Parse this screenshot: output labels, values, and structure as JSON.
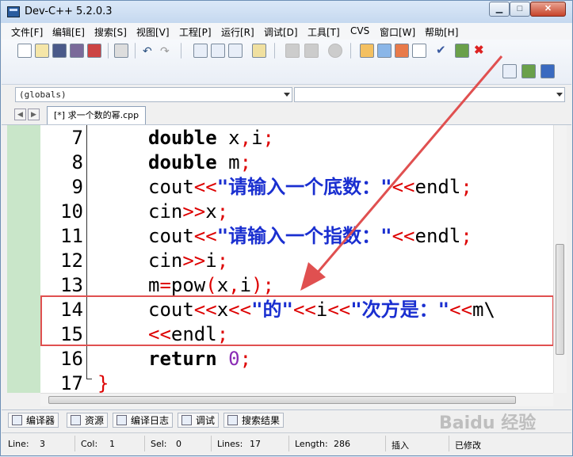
{
  "window": {
    "title": "Dev-C++ 5.2.0.3"
  },
  "menu": [
    "文件[F]",
    "编辑[E]",
    "搜索[S]",
    "视图[V]",
    "工程[P]",
    "运行[R]",
    "调试[D]",
    "工具[T]",
    "CVS",
    "窗口[W]",
    "帮助[H]"
  ],
  "scope_combo": {
    "value": "(globals)"
  },
  "tab": {
    "label": "[*] 求一个数的幂.cpp"
  },
  "code_lines": [
    {
      "num": "7",
      "segments": [
        {
          "t": "double",
          "c": "kw"
        },
        {
          "t": " x",
          "c": ""
        },
        {
          "t": ",",
          "c": "op"
        },
        {
          "t": "i",
          "c": ""
        },
        {
          "t": ";",
          "c": "op"
        }
      ]
    },
    {
      "num": "8",
      "segments": [
        {
          "t": "double",
          "c": "kw"
        },
        {
          "t": " m",
          "c": ""
        },
        {
          "t": ";",
          "c": "op"
        }
      ]
    },
    {
      "num": "9",
      "segments": [
        {
          "t": "cout",
          "c": ""
        },
        {
          "t": "<<",
          "c": "op"
        },
        {
          "t": "\"请输入一个底数：\"",
          "c": "str"
        },
        {
          "t": "<<",
          "c": "op"
        },
        {
          "t": "endl",
          "c": ""
        },
        {
          "t": ";",
          "c": "op"
        }
      ]
    },
    {
      "num": "10",
      "segments": [
        {
          "t": "cin",
          "c": ""
        },
        {
          "t": ">>",
          "c": "op"
        },
        {
          "t": "x",
          "c": ""
        },
        {
          "t": ";",
          "c": "op"
        }
      ]
    },
    {
      "num": "11",
      "segments": [
        {
          "t": "cout",
          "c": ""
        },
        {
          "t": "<<",
          "c": "op"
        },
        {
          "t": "\"请输入一个指数：\"",
          "c": "str"
        },
        {
          "t": "<<",
          "c": "op"
        },
        {
          "t": "endl",
          "c": ""
        },
        {
          "t": ";",
          "c": "op"
        }
      ]
    },
    {
      "num": "12",
      "segments": [
        {
          "t": "cin",
          "c": ""
        },
        {
          "t": ">>",
          "c": "op"
        },
        {
          "t": "i",
          "c": ""
        },
        {
          "t": ";",
          "c": "op"
        }
      ]
    },
    {
      "num": "13",
      "segments": [
        {
          "t": "m",
          "c": ""
        },
        {
          "t": "=",
          "c": "op"
        },
        {
          "t": "pow",
          "c": ""
        },
        {
          "t": "(",
          "c": "op"
        },
        {
          "t": "x",
          "c": ""
        },
        {
          "t": ",",
          "c": "op"
        },
        {
          "t": "i",
          "c": ""
        },
        {
          "t": ")",
          "c": "op"
        },
        {
          "t": ";",
          "c": "op"
        }
      ]
    },
    {
      "num": "14",
      "segments": [
        {
          "t": "cout",
          "c": ""
        },
        {
          "t": "<<",
          "c": "op"
        },
        {
          "t": "x",
          "c": ""
        },
        {
          "t": "<<",
          "c": "op"
        },
        {
          "t": "\"的\"",
          "c": "str"
        },
        {
          "t": "<<",
          "c": "op"
        },
        {
          "t": "i",
          "c": ""
        },
        {
          "t": "<<",
          "c": "op"
        },
        {
          "t": "\"次方是：\"",
          "c": "str"
        },
        {
          "t": "<<",
          "c": "op"
        },
        {
          "t": "m\\",
          "c": ""
        }
      ]
    },
    {
      "num": "15",
      "segments": [
        {
          "t": "<<",
          "c": "op"
        },
        {
          "t": "endl",
          "c": ""
        },
        {
          "t": ";",
          "c": "op"
        }
      ]
    },
    {
      "num": "16",
      "segments": [
        {
          "t": "return",
          "c": "kw"
        },
        {
          "t": " ",
          "c": ""
        },
        {
          "t": "0",
          "c": "num"
        },
        {
          "t": ";",
          "c": "op"
        }
      ]
    },
    {
      "num": "17",
      "segments": [
        {
          "t": "}",
          "c": "op"
        }
      ]
    }
  ],
  "bottom_tabs": [
    "编译器",
    "资源",
    "编译日志",
    "调试",
    "搜索结果"
  ],
  "status": {
    "line_label": "Line:",
    "line_value": "3",
    "col_label": "Col:",
    "col_value": "1",
    "sel_label": "Sel:",
    "sel_value": "0",
    "lines_label": "Lines:",
    "lines_value": "17",
    "length_label": "Length:",
    "length_value": "286",
    "mode": "插入",
    "modified": "已修改"
  },
  "watermark": "Baidu 经验",
  "colors": {
    "annotation_red": "#e05050",
    "gutter_green": "#c9e6c9"
  }
}
